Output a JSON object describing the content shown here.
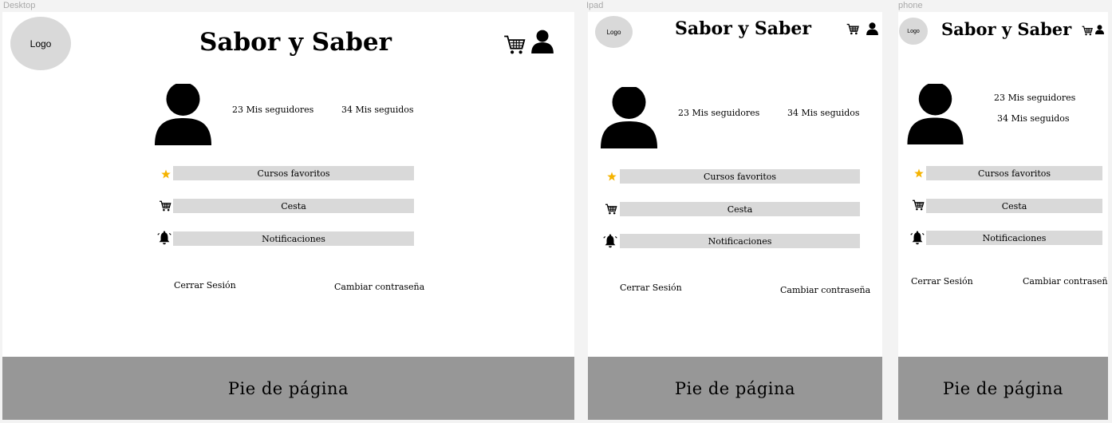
{
  "frames": {
    "desktop": {
      "label": "Desktop"
    },
    "ipad": {
      "label": "Ipad"
    },
    "phone": {
      "label": "phone"
    }
  },
  "header": {
    "logo_text": "Logo",
    "brand": "Sabor y Saber",
    "icons": [
      "cart-icon",
      "user-icon"
    ]
  },
  "profile": {
    "followers": "23 Mis seguidores",
    "following": "34 Mis seguidos"
  },
  "menu": {
    "favorites": "Cursos favoritos",
    "cart": "Cesta",
    "notifications": "Notificaciones"
  },
  "actions": {
    "logout": "Cerrar Sesión",
    "change_password": "Cambiar contraseña"
  },
  "footer": {
    "text": "Pie de página"
  },
  "colors": {
    "star": "#f5b300",
    "bar": "#d9d9d9",
    "footer": "#979797"
  }
}
